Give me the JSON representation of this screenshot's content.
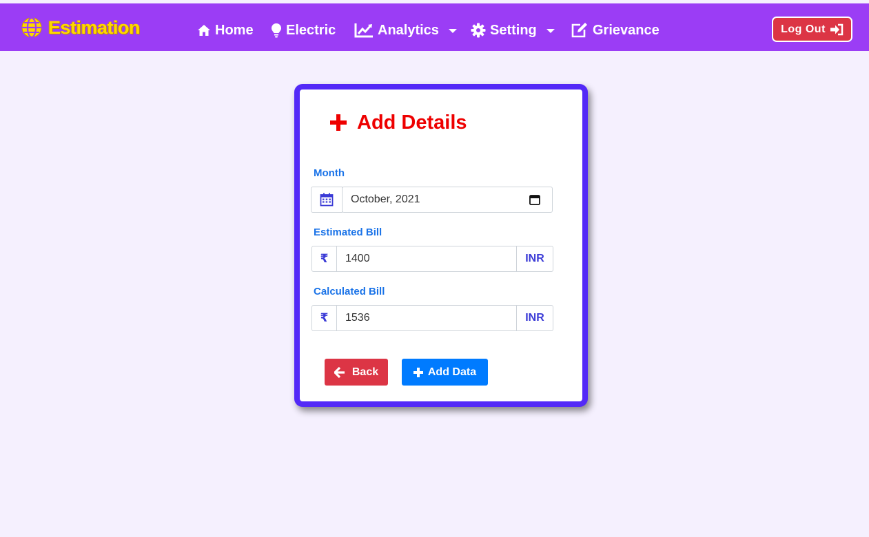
{
  "navbar": {
    "brand": "Estimation",
    "brand_icon": "globe-icon",
    "items": [
      {
        "label": "Home",
        "icon": "home-icon"
      },
      {
        "label": "Electric",
        "icon": "lightbulb-icon"
      },
      {
        "label": "Analytics",
        "icon": "chart-line-icon"
      },
      {
        "label": "Setting",
        "icon": "gear-icon"
      },
      {
        "label": "Grievance",
        "icon": "edit-icon"
      }
    ],
    "logout_label": "Log Out",
    "colors": {
      "bar": "#9b3df5",
      "brand": "#ffd700",
      "logout": "#dc3545"
    }
  },
  "form": {
    "title": "Add Details",
    "month_label": "Month",
    "month_value": "October, 2021",
    "estimated_label": "Estimated Bill",
    "estimated_value": "1400",
    "calculated_label": "Calculated Bill",
    "calculated_value": "1536",
    "currency_symbol": "₹",
    "currency_unit": "INR",
    "back_label": "Back",
    "add_label": "Add Data",
    "colors": {
      "border": "#5329f7",
      "title": "#ee0000",
      "label": "#1a73e8",
      "back": "#dc3545",
      "add": "#007bff"
    }
  }
}
